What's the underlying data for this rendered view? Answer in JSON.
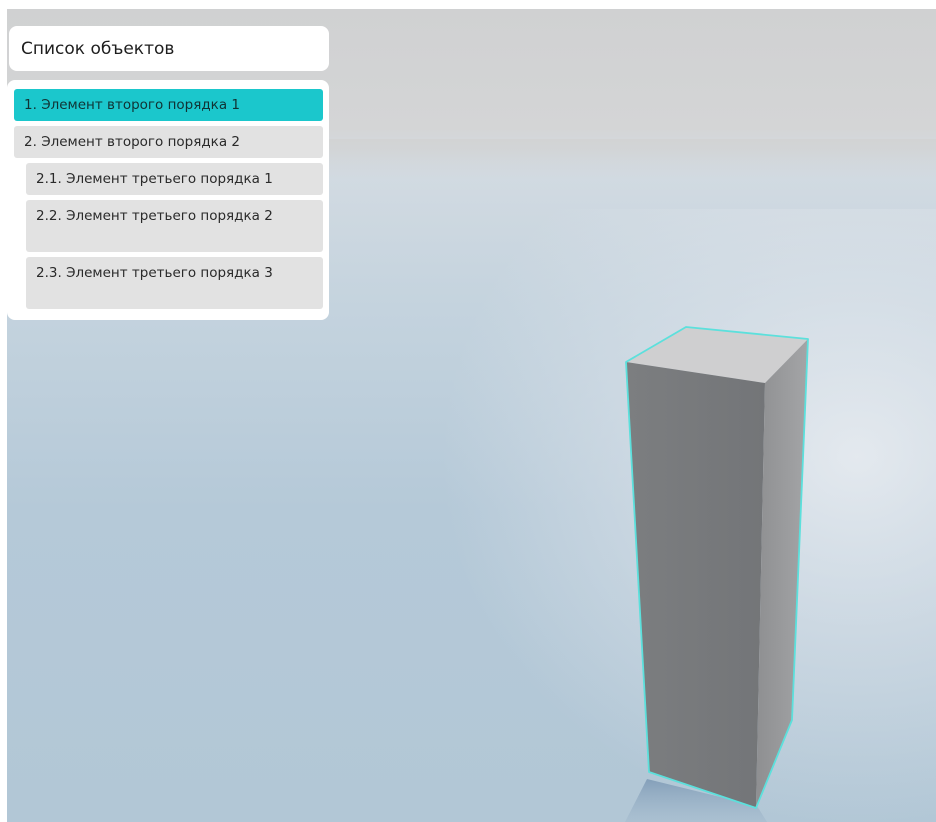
{
  "panel": {
    "title": "Список объектов",
    "items": [
      {
        "number": "1.",
        "label": "Элемент второго порядка  1",
        "selected": true,
        "level": 2
      },
      {
        "number": "2.",
        "label": "Элемент второго порядка  2",
        "selected": false,
        "level": 2
      },
      {
        "number": "2.1.",
        "label": "Элемент третьего порядка  1",
        "selected": false,
        "level": 3
      },
      {
        "number": "2.2.",
        "label": "Элемент третьего порядка 2",
        "selected": false,
        "level": 3
      },
      {
        "number": "2.3.",
        "label": "Элемент третьего порядка 3",
        "selected": false,
        "level": 3
      }
    ]
  },
  "scene": {
    "object": "box",
    "highlight_color": "#5ce0dc",
    "selection_color": "#1bc7cc"
  }
}
